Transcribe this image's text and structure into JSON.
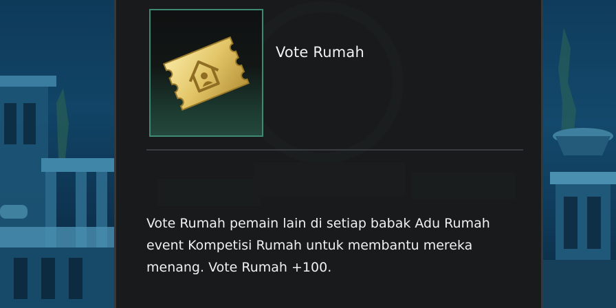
{
  "item": {
    "name": "Vote Rumah",
    "icon": "house-vote-ticket-icon",
    "frame_color": "#3e8a72"
  },
  "description": {
    "lines": [
      "Vote Rumah pemain lain di setiap babak Adu Rumah",
      "event Kompetisi Rumah untuk membantu mereka",
      "menang. Vote Rumah +100."
    ]
  },
  "colors": {
    "panel_background": "#181a1b",
    "text": "#f0f0f0",
    "ticket_gold": "#e2c567",
    "scene_background": "#114466"
  }
}
